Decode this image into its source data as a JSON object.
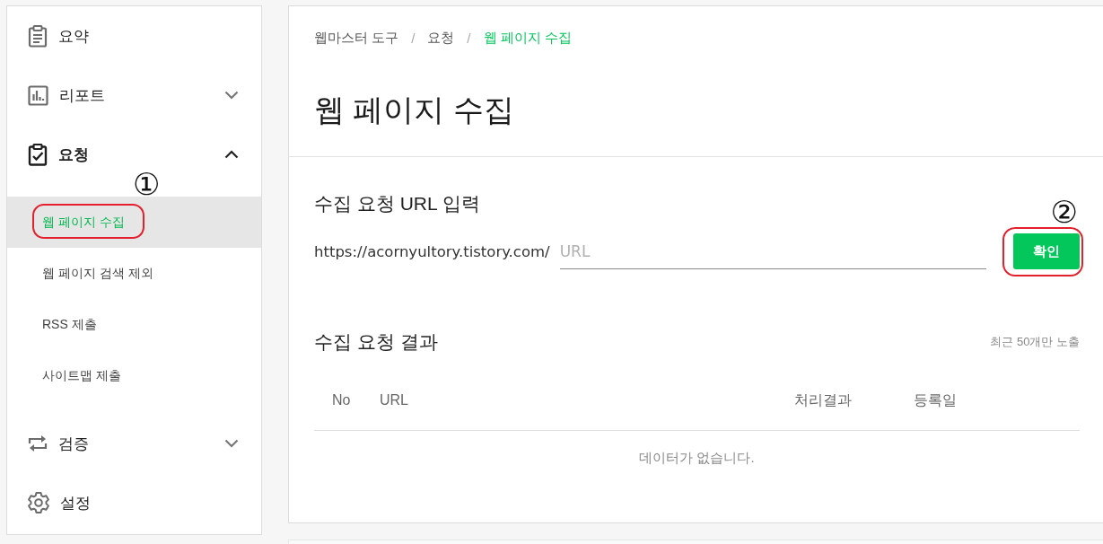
{
  "sidebar": {
    "items": [
      {
        "kind": "link",
        "label": "요약",
        "selected": false
      },
      {
        "kind": "group",
        "label": "리포트",
        "selected": false,
        "expanded": false
      },
      {
        "kind": "group",
        "label": "요청",
        "selected": true,
        "expanded": true,
        "children": [
          {
            "label": "웹 페이지 수집",
            "selected": true,
            "annotation": "①"
          },
          {
            "label": "웹 페이지 검색 제외",
            "selected": false
          },
          {
            "label": "RSS 제출",
            "selected": false
          },
          {
            "label": "사이트맵 제출",
            "selected": false
          }
        ]
      },
      {
        "kind": "group",
        "label": "검증",
        "selected": false,
        "expanded": false
      },
      {
        "kind": "link",
        "label": "설정",
        "selected": false
      }
    ]
  },
  "breadcrumb": {
    "items": [
      {
        "label": "웹마스터 도구",
        "current": false
      },
      {
        "separator": "/",
        "label": "요청",
        "current": false
      },
      {
        "separator": "/",
        "label": "웹 페이지 수집",
        "current": true
      }
    ]
  },
  "page_title": "웹 페이지 수집",
  "url_section": {
    "title": "수집 요청 URL 입력",
    "prefix": "https://acornyultory.tistory.com/",
    "input": {
      "placeholder": "URL"
    },
    "button": {
      "label": "확인",
      "annotation": "②"
    }
  },
  "results": {
    "title": "수집 요청 결과",
    "note": "최근 50개만 노출",
    "table": {
      "columns": [
        "No",
        "URL",
        "처리결과",
        "등록일"
      ],
      "empty_message": "데이터가 없습니다."
    }
  }
}
